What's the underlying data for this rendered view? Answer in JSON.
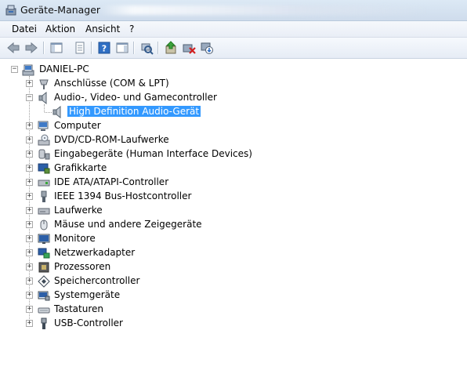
{
  "window": {
    "title": "Geräte-Manager"
  },
  "menu": [
    "Datei",
    "Aktion",
    "Ansicht",
    "?"
  ],
  "toolbar": [
    {
      "icon": "back-icon"
    },
    {
      "icon": "forward-icon"
    },
    {
      "icon": "show-hide-console-tree-icon"
    },
    {
      "icon": "properties-icon"
    },
    {
      "icon": "help-icon"
    },
    {
      "icon": "show-action-pane-icon"
    },
    {
      "icon": "scan-hardware-icon"
    },
    {
      "icon": "update-driver-icon"
    },
    {
      "icon": "uninstall-icon"
    },
    {
      "icon": "disable-icon"
    }
  ],
  "tree": {
    "root": "DANIEL-PC",
    "categories": [
      {
        "label": "Anschlüsse (COM & LPT)",
        "icon": "port-icon"
      },
      {
        "label": "Audio-, Video- und Gamecontroller",
        "icon": "speaker-icon",
        "expanded": true,
        "children": [
          {
            "label": "High Definition Audio-Gerät",
            "icon": "speaker-icon",
            "selected": true
          }
        ]
      },
      {
        "label": "Computer",
        "icon": "computer-icon"
      },
      {
        "label": "DVD/CD-ROM-Laufwerke",
        "icon": "dvd-drive-icon"
      },
      {
        "label": "Eingabegeräte (Human Interface Devices)",
        "icon": "hid-icon"
      },
      {
        "label": "Grafikkarte",
        "icon": "display-adapter-icon"
      },
      {
        "label": "IDE ATA/ATAPI-Controller",
        "icon": "ide-controller-icon"
      },
      {
        "label": "IEEE 1394 Bus-Hostcontroller",
        "icon": "firewire-icon"
      },
      {
        "label": "Laufwerke",
        "icon": "disk-drive-icon"
      },
      {
        "label": "Mäuse und andere Zeigegeräte",
        "icon": "mouse-icon"
      },
      {
        "label": "Monitore",
        "icon": "monitor-icon"
      },
      {
        "label": "Netzwerkadapter",
        "icon": "network-adapter-icon"
      },
      {
        "label": "Prozessoren",
        "icon": "processor-icon"
      },
      {
        "label": "Speichercontroller",
        "icon": "storage-controller-icon"
      },
      {
        "label": "Systemgeräte",
        "icon": "system-devices-icon"
      },
      {
        "label": "Tastaturen",
        "icon": "keyboard-icon"
      },
      {
        "label": "USB-Controller",
        "icon": "usb-icon"
      }
    ]
  },
  "colors": {
    "selection": "#3399ff",
    "titlebar": "#dce9f5"
  }
}
